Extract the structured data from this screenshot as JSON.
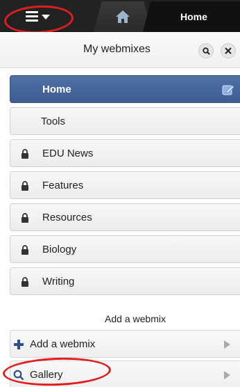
{
  "topbar": {
    "home_tab_label": "Home",
    "menu_icon": "hamburger-menu-icon",
    "home_icon": "house-icon"
  },
  "panel": {
    "title": "My webmixes",
    "search_icon": "search-icon",
    "close_icon": "close-icon"
  },
  "webmixes": [
    {
      "label": "Home",
      "active": true,
      "locked": false
    },
    {
      "label": "Tools",
      "active": false,
      "locked": false
    },
    {
      "label": "EDU News",
      "active": false,
      "locked": true
    },
    {
      "label": "Features",
      "active": false,
      "locked": true
    },
    {
      "label": "Resources",
      "active": false,
      "locked": true
    },
    {
      "label": "Biology",
      "active": false,
      "locked": true
    },
    {
      "label": "Writing",
      "active": false,
      "locked": true
    }
  ],
  "add_section": {
    "heading": "Add a webmix",
    "add_label": "Add a webmix",
    "gallery_label": "Gallery"
  },
  "colors": {
    "accent": "#4a6aa1",
    "annotation": "#e01e1e",
    "plus": "#2c4f8c"
  }
}
